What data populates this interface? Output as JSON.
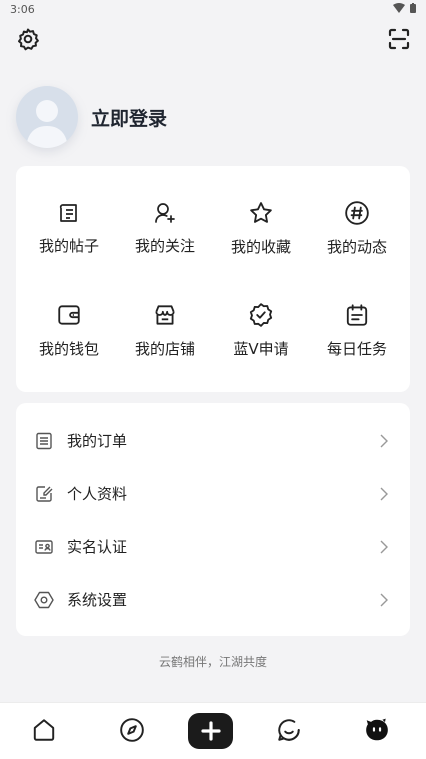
{
  "status_bar": {
    "time": "3:06"
  },
  "profile": {
    "login_label": "立即登录"
  },
  "grid": {
    "items": [
      {
        "label": "我的帖子",
        "icon": "post-icon"
      },
      {
        "label": "我的关注",
        "icon": "follow-icon"
      },
      {
        "label": "我的收藏",
        "icon": "star-icon"
      },
      {
        "label": "我的动态",
        "icon": "hashtag-icon"
      },
      {
        "label": "我的钱包",
        "icon": "wallet-icon"
      },
      {
        "label": "我的店铺",
        "icon": "store-icon"
      },
      {
        "label": "蓝V申请",
        "icon": "verified-badge-icon"
      },
      {
        "label": "每日任务",
        "icon": "calendar-task-icon"
      }
    ]
  },
  "list": {
    "items": [
      {
        "label": "我的订单",
        "icon": "order-icon"
      },
      {
        "label": "个人资料",
        "icon": "profile-edit-icon"
      },
      {
        "label": "实名认证",
        "icon": "id-card-icon"
      },
      {
        "label": "系统设置",
        "icon": "hexagon-settings-icon"
      }
    ]
  },
  "footer": {
    "slogan": "云鹤相伴，江湖共度"
  },
  "colors": {
    "background": "#f3f3f5",
    "card": "#ffffff",
    "text": "#222222",
    "avatar_bg": "#d7dfea",
    "nav_add_bg": "#1b1b1b"
  }
}
